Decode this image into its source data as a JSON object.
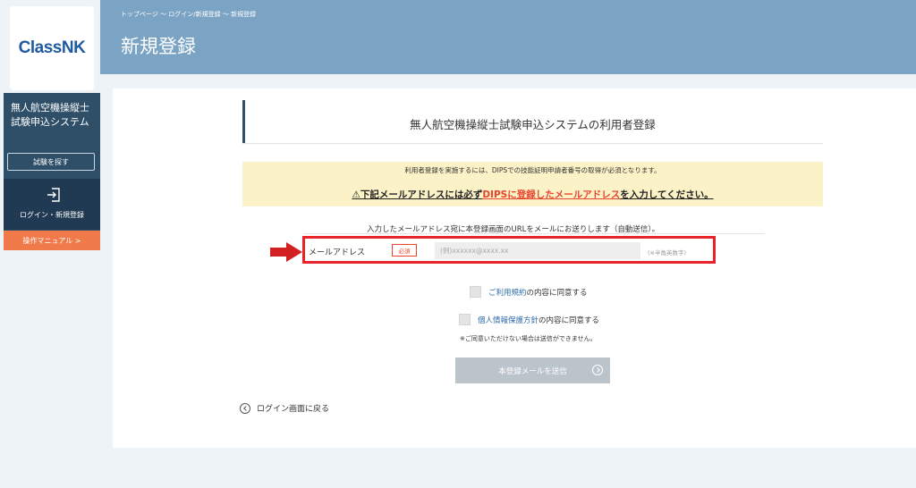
{
  "sidebar": {
    "logo": "ClassNK",
    "system_name_line1": "無人航空機操縦士",
    "system_name_line2": "試験申込システム",
    "search_label": "試験を探す",
    "login_label": "ログイン・新規登録",
    "manual_label": "操作マニュアル >"
  },
  "header": {
    "breadcrumb": "トップページ ～ ログイン/新規登録 ～ 新規登録",
    "title": "新規登録"
  },
  "main": {
    "section_title": "無人航空機操縦士試験申込システムの利用者登録",
    "notice_line1": "利用者登録を実施するには、DIPSでの技能証明申請者番号の取得が必須となります。",
    "notice_line2_prefix": "⚠下記メールアドレスには必ず",
    "notice_line2_highlight": "DIPSに登録したメールアドレス",
    "notice_line2_suffix": "を入力してください。",
    "send_note": "入力したメールアドレス宛に本登録画面のURLをメールにお送りします（自動送信）。",
    "email_label": "メールアドレス",
    "required_badge": "必須",
    "email_placeholder": "(例)xxxxxx@xxxx.xx",
    "email_hint": "(※半角英数字)",
    "terms_link": "ご利用規約",
    "terms_suffix": "の内容に同意する",
    "privacy_link": "個人情報保護方針",
    "privacy_suffix": "の内容に同意する",
    "disclaimer": "※ご同意いただけない場合は送信ができません。",
    "submit_label": "本登録メールを送信",
    "back_label": "ログイン画面に戻る"
  },
  "colors": {
    "header_bg": "#7ba3c4",
    "sidebar_dark": "#2f4f68",
    "manual_orange": "#f07a4a",
    "highlight_red": "#e8232a",
    "notice_bg": "#fcf2c7"
  }
}
